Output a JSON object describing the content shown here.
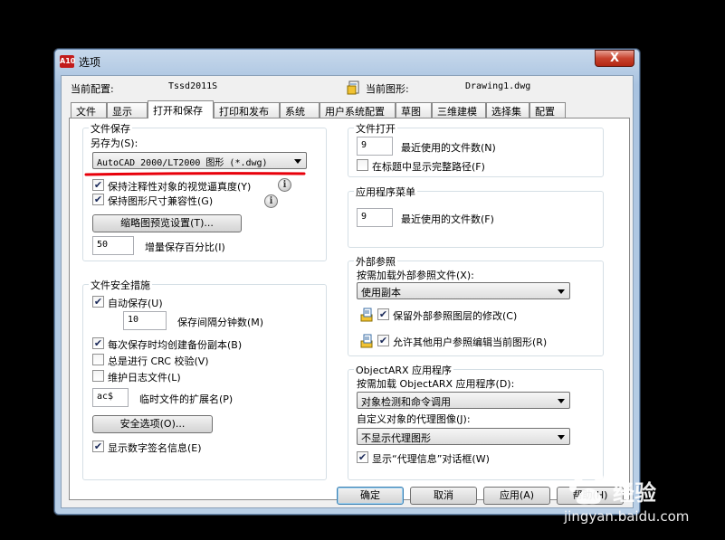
{
  "window": {
    "title": "选项",
    "app_icon_text": "A10",
    "close_label": "X"
  },
  "profile": {
    "current_profile_label": "当前配置:",
    "current_profile_value": "Tssd2011S",
    "current_drawing_label": "当前图形:",
    "current_drawing_value": "Drawing1.dwg"
  },
  "tabs": [
    {
      "label": "文件",
      "active": false
    },
    {
      "label": "显示",
      "active": false
    },
    {
      "label": "打开和保存",
      "active": true
    },
    {
      "label": "打印和发布",
      "active": false
    },
    {
      "label": "系统",
      "active": false
    },
    {
      "label": "用户系统配置",
      "active": false
    },
    {
      "label": "草图",
      "active": false
    },
    {
      "label": "三维建模",
      "active": false
    },
    {
      "label": "选择集",
      "active": false
    },
    {
      "label": "配置",
      "active": false
    }
  ],
  "file_save": {
    "title": "文件保存",
    "save_as_label": "另存为(S):",
    "save_as_value": "AutoCAD 2000/LT2000 图形 (*.dwg)",
    "maintain_visual_fidelity": {
      "label": "保持注释性对象的视觉逼真度(Y)",
      "checked": true
    },
    "maintain_drawing_size": {
      "label": "保持图形尺寸兼容性(G)",
      "checked": true
    },
    "thumbnail_button": "缩略图预览设置(T)...",
    "incremental_value": "50",
    "incremental_label": "增量保存百分比(I)"
  },
  "file_safety": {
    "title": "文件安全措施",
    "autosave": {
      "label": "自动保存(U)",
      "checked": true
    },
    "autosave_minutes_value": "10",
    "autosave_minutes_label": "保存间隔分钟数(M)",
    "backup_copy": {
      "label": "每次保存时均创建备份副本(B)",
      "checked": true
    },
    "crc_validation": {
      "label": "总是进行 CRC 校验(V)",
      "checked": false
    },
    "log_file": {
      "label": "维护日志文件(L)",
      "checked": false
    },
    "temp_ext_value": "ac$",
    "temp_ext_label": "临时文件的扩展名(P)",
    "security_button": "安全选项(O)...",
    "digital_signature": {
      "label": "显示数字签名信息(E)",
      "checked": true
    }
  },
  "file_open": {
    "title": "文件打开",
    "recent_value": "9",
    "recent_label": "最近使用的文件数(N)",
    "full_path": {
      "label": "在标题中显示完整路径(F)",
      "checked": false
    }
  },
  "app_menu": {
    "title": "应用程序菜单",
    "recent_value": "9",
    "recent_label": "最近使用的文件数(F)"
  },
  "xref": {
    "title": "外部参照",
    "demand_load_label": "按需加载外部参照文件(X):",
    "demand_load_value": "使用副本",
    "retain_changes": {
      "label": "保留外部参照图层的修改(C)",
      "checked": true
    },
    "allow_edit": {
      "label": "允许其他用户参照编辑当前图形(R)",
      "checked": true
    }
  },
  "objectarx": {
    "title": "ObjectARX 应用程序",
    "demand_load_label": "按需加载 ObjectARX 应用程序(D):",
    "demand_load_value": "对象检测和命令调用",
    "proxy_images_label": "自定义对象的代理图像(J):",
    "proxy_images_value": "不显示代理图形",
    "proxy_info": {
      "label": "显示“代理信息”对话框(W)",
      "checked": true
    }
  },
  "buttons": {
    "ok": "确定",
    "cancel": "取消",
    "apply": "应用(A)",
    "help": "帮助(H)"
  },
  "watermark": {
    "brand": "经验",
    "url": "jingyan.baidu.com"
  },
  "colors": {
    "annotation_underline": "#e8000b",
    "title_bar": "#b9cfe6",
    "close_button": "#c7432e"
  }
}
